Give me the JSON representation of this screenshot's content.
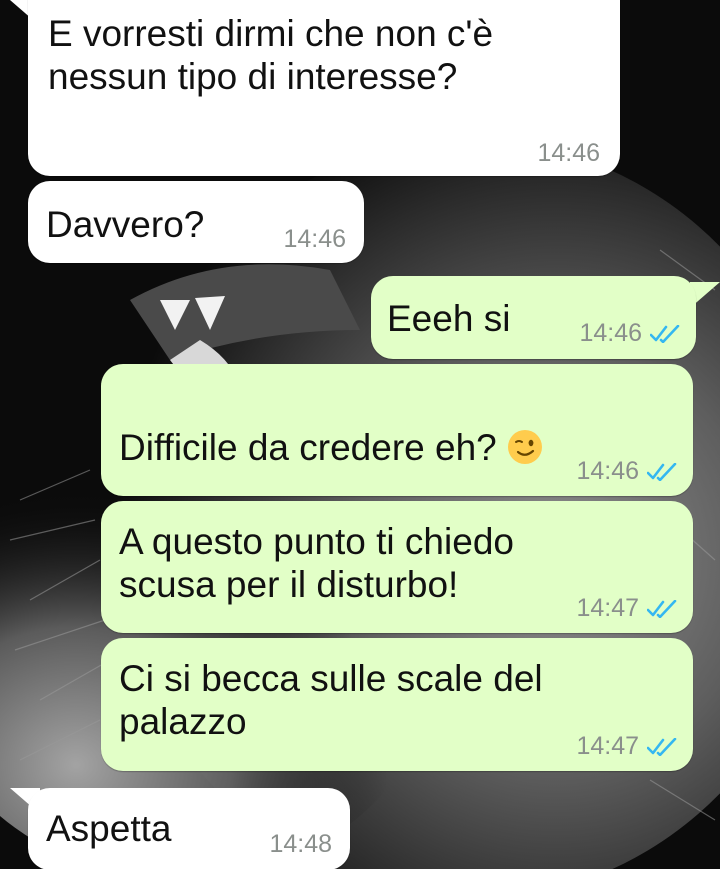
{
  "chat": {
    "messages": [
      {
        "direction": "incoming",
        "text": "E vorresti dirmi che non c'è\nnessun tipo di interesse?",
        "time": "14:46"
      },
      {
        "direction": "incoming",
        "text": "Davvero?",
        "time": "14:46"
      },
      {
        "direction": "outgoing",
        "text": "Eeeh si",
        "time": "14:46",
        "status": "read"
      },
      {
        "direction": "outgoing",
        "text": "Difficile da credere eh?",
        "emoji": "winking-face",
        "time": "14:46",
        "status": "read"
      },
      {
        "direction": "outgoing",
        "text": "A questo punto ti chiedo\nscusa per il disturbo!",
        "time": "14:47",
        "status": "read"
      },
      {
        "direction": "outgoing",
        "text": "Ci si becca sulle scale del\npalazzo",
        "time": "14:47",
        "status": "read"
      },
      {
        "direction": "incoming",
        "text": "Aspetta",
        "time": "14:48"
      }
    ]
  },
  "colors": {
    "incoming_bubble": "#ffffff",
    "outgoing_bubble": "#e2ffc7",
    "read_ticks": "#34b7f1",
    "timestamp": "#8a8f8c",
    "wallpaper": "#0b0b0b"
  },
  "icons": {
    "read_receipt": "double-check-icon",
    "wallpaper": "lion-wallpaper"
  }
}
